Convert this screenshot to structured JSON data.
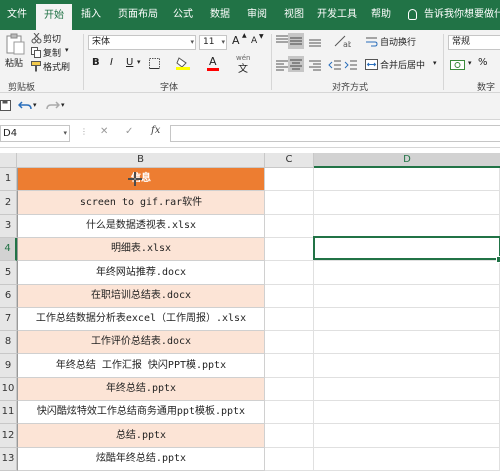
{
  "ribbon_tabs": [
    "文件",
    "开始",
    "插入",
    "页面布局",
    "公式",
    "数据",
    "审阅",
    "视图",
    "开发工具",
    "帮助"
  ],
  "tell_me": "告诉我你想要做什么",
  "clipboard": {
    "paste": "粘贴",
    "cut": "剪切",
    "copy": "复制",
    "format_painter": "格式刷",
    "label": "剪贴板"
  },
  "font": {
    "name": "宋体",
    "size": "11",
    "bold": "B",
    "italic": "I",
    "underline": "U",
    "grow": "A",
    "shrink": "A",
    "fill_letter": "A",
    "wen": "wén",
    "label": "字体"
  },
  "alignment": {
    "wrap": "自动换行",
    "merge": "合并后居中",
    "label": "对齐方式"
  },
  "number": {
    "format": "常规",
    "label": "数字"
  },
  "formula_bar": {
    "name_box": "D4",
    "fx": "fx",
    "cancel": "✕",
    "enter": "✓"
  },
  "columns": [
    "B",
    "C",
    "D"
  ],
  "rows": [
    {
      "num": "1",
      "text": "信息"
    },
    {
      "num": "2",
      "text": "screen to gif.rar软件"
    },
    {
      "num": "3",
      "text": "什么是数据透视表.xlsx"
    },
    {
      "num": "4",
      "text": "明细表.xlsx"
    },
    {
      "num": "5",
      "text": "年终网站推荐.docx"
    },
    {
      "num": "6",
      "text": "在职培训总结表.docx"
    },
    {
      "num": "7",
      "text": "工作总结数据分析表excel（工作周报）.xlsx"
    },
    {
      "num": "8",
      "text": "工作评价总结表.docx"
    },
    {
      "num": "9",
      "text": "年终总结 工作汇报 快闪PPT模.pptx"
    },
    {
      "num": "10",
      "text": "年终总结.pptx"
    },
    {
      "num": "11",
      "text": "快闪酷炫特效工作总结商务通用ppt模板.pptx"
    },
    {
      "num": "12",
      "text": "总结.pptx"
    },
    {
      "num": "13",
      "text": "炫酷年终总结.pptx"
    }
  ],
  "colors": {
    "excel_green": "#217346",
    "header_fill": "#ed7d31",
    "band_fill": "#fce4d6",
    "font_red": "#ff0000",
    "fill_yellow": "#ffff00"
  }
}
